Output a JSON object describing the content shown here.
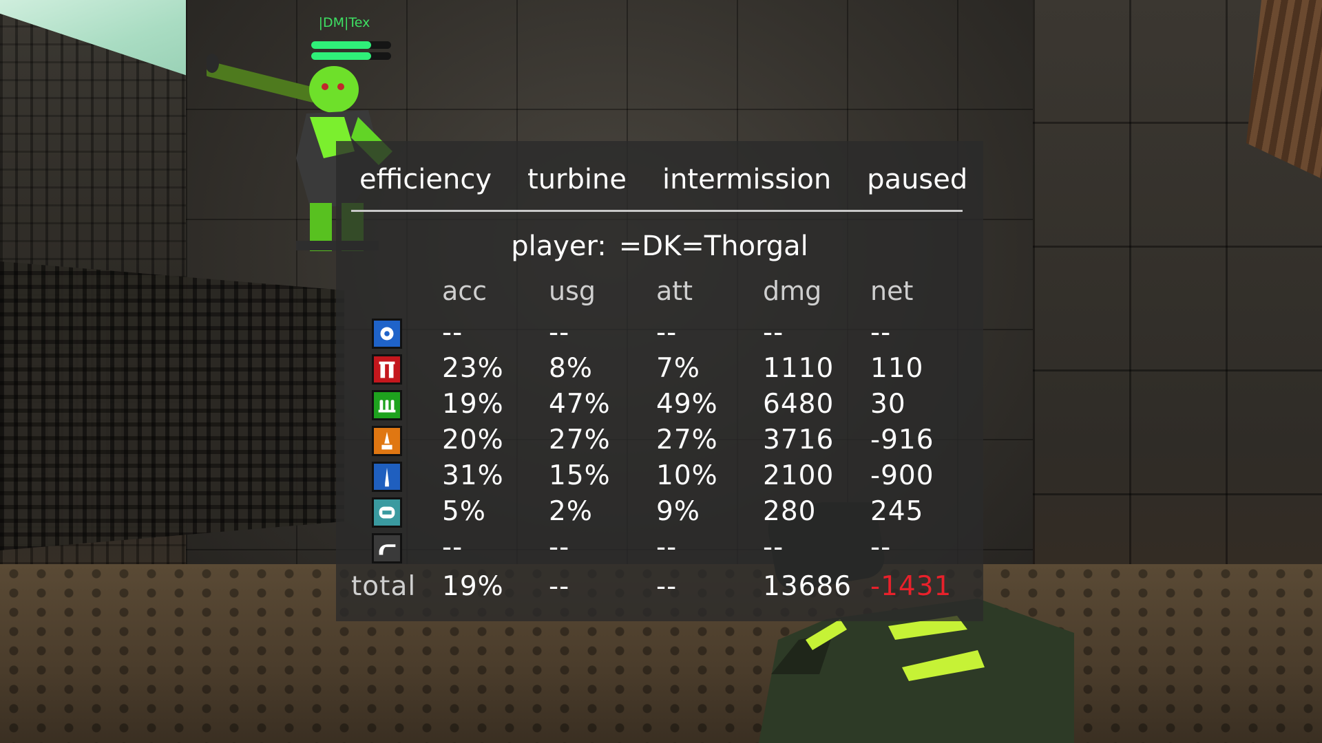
{
  "hud": {
    "nametag": "|DM|Tex",
    "health_fraction": 0.75,
    "armor_fraction": 0.75
  },
  "stats": {
    "tabs": [
      "efficiency",
      "turbine",
      "intermission",
      "paused"
    ],
    "player_label": "player:",
    "player_name": "=DK=Thorgal",
    "columns": [
      "acc",
      "usg",
      "att",
      "dmg",
      "net"
    ],
    "rows": [
      {
        "weapon": "gauntlet-icon",
        "color": "#1f63c9",
        "acc": "--",
        "usg": "--",
        "att": "--",
        "dmg": "--",
        "net": "--"
      },
      {
        "weapon": "shotgun-icon",
        "color": "#c4171d",
        "acc": "23%",
        "usg": "8%",
        "att": "7%",
        "dmg": "1110",
        "net": "110"
      },
      {
        "weapon": "nailgun-icon",
        "color": "#1ea21e",
        "acc": "19%",
        "usg": "47%",
        "att": "49%",
        "dmg": "6480",
        "net": "30"
      },
      {
        "weapon": "rocket-launcher-icon",
        "color": "#e07712",
        "acc": "20%",
        "usg": "27%",
        "att": "27%",
        "dmg": "3716",
        "net": "-916"
      },
      {
        "weapon": "railgun-icon",
        "color": "#1f5fbf",
        "acc": "31%",
        "usg": "15%",
        "att": "10%",
        "dmg": "2100",
        "net": "-900"
      },
      {
        "weapon": "lightning-gun-icon",
        "color": "#3a9aa0",
        "acc": "5%",
        "usg": "2%",
        "att": "9%",
        "dmg": "280",
        "net": "245"
      },
      {
        "weapon": "machinegun-icon",
        "color": "#3a3a3a",
        "acc": "--",
        "usg": "--",
        "att": "--",
        "dmg": "--",
        "net": "--"
      }
    ],
    "total": {
      "label": "total",
      "acc": "19%",
      "usg": "--",
      "att": "--",
      "dmg": "13686",
      "net": "-1431",
      "net_color": "#e8212b"
    }
  }
}
